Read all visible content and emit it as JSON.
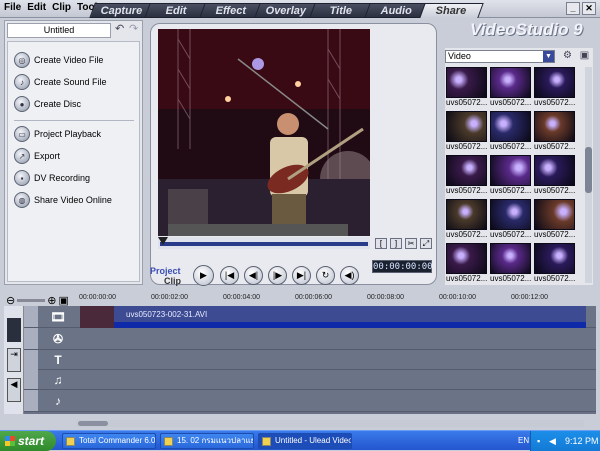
{
  "menu": [
    "File",
    "Edit",
    "Clip",
    "Tools"
  ],
  "steps": [
    "Capture",
    "Edit",
    "Effect",
    "Overlay",
    "Title",
    "Audio",
    "Share"
  ],
  "active_step": "Share",
  "project_title": "Untitled",
  "share_items": [
    "Create Video File",
    "Create Sound File",
    "Create Disc",
    "Project Playback",
    "Export",
    "DV Recording",
    "Share Video Online"
  ],
  "logo": "VideoStudio 9",
  "library": {
    "category": "Video",
    "thumb_label": "uvs05072..."
  },
  "player": {
    "project_label": "Project",
    "clip_label": "Clip",
    "timecode": "00:00:00:00"
  },
  "ruler_ticks": [
    "00:00:00:00",
    "00:00:02:00",
    "00:00:04:00",
    "00:00:06:00",
    "00:00:08:00",
    "00:00:10:00",
    "00:00:12:00"
  ],
  "timeline_clip": "uvs050723-002-31.AVI",
  "taskbar": {
    "start": "start",
    "tasks": [
      "Total Commander 6.0...",
      "15. 02 กรมแนวปลาแยก...",
      "Untitled - Ulead Video..."
    ],
    "lang": "EN",
    "clock": "9:12 PM"
  },
  "colors": {
    "accent": "#2a3a8a",
    "clip": "#3d4b93",
    "taskbar": "#2356cf"
  }
}
